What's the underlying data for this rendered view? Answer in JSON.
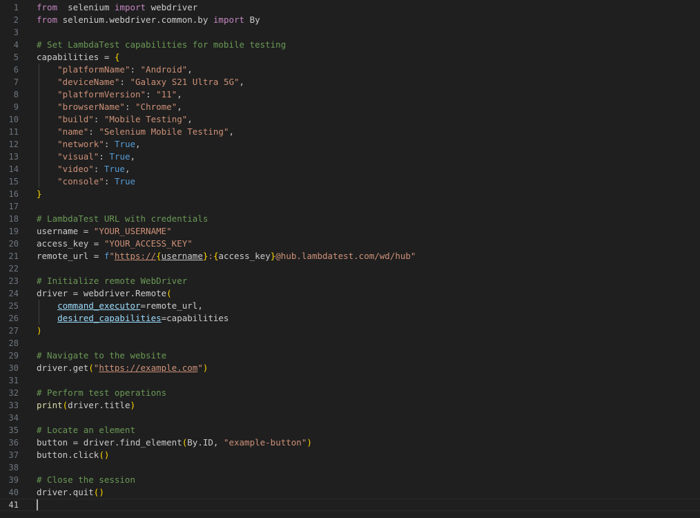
{
  "editor": {
    "current_line": 41,
    "lines": [
      {
        "n": "1",
        "tokens": [
          [
            "kw",
            "from"
          ],
          [
            "",
            "  selenium "
          ],
          [
            "kw",
            "import"
          ],
          [
            "",
            " webdriver"
          ]
        ]
      },
      {
        "n": "2",
        "tokens": [
          [
            "kw",
            "from"
          ],
          [
            "",
            " selenium.webdriver.common.by "
          ],
          [
            "kw",
            "import"
          ],
          [
            "",
            " By"
          ]
        ]
      },
      {
        "n": "3",
        "tokens": []
      },
      {
        "n": "4",
        "tokens": [
          [
            "cm",
            "# Set LambdaTest capabilities for mobile testing"
          ]
        ]
      },
      {
        "n": "5",
        "tokens": [
          [
            "",
            "capabilities = "
          ],
          [
            "br1",
            "{"
          ]
        ]
      },
      {
        "n": "6",
        "tokens": [
          [
            "",
            "    "
          ],
          [
            "st",
            "\"platformName\""
          ],
          [
            "",
            ": "
          ],
          [
            "st",
            "\"Android\""
          ],
          [
            "",
            ","
          ]
        ]
      },
      {
        "n": "7",
        "tokens": [
          [
            "",
            "    "
          ],
          [
            "st",
            "\"deviceName\""
          ],
          [
            "",
            ": "
          ],
          [
            "st",
            "\"Galaxy S21 Ultra 5G\""
          ],
          [
            "",
            ","
          ]
        ]
      },
      {
        "n": "8",
        "tokens": [
          [
            "",
            "    "
          ],
          [
            "st",
            "\"platformVersion\""
          ],
          [
            "",
            ": "
          ],
          [
            "st",
            "\"11\""
          ],
          [
            "",
            ","
          ]
        ]
      },
      {
        "n": "9",
        "tokens": [
          [
            "",
            "    "
          ],
          [
            "st",
            "\"browserName\""
          ],
          [
            "",
            ": "
          ],
          [
            "st",
            "\"Chrome\""
          ],
          [
            "",
            ","
          ]
        ]
      },
      {
        "n": "10",
        "tokens": [
          [
            "",
            "    "
          ],
          [
            "st",
            "\"build\""
          ],
          [
            "",
            ": "
          ],
          [
            "st",
            "\"Mobile Testing\""
          ],
          [
            "",
            ","
          ]
        ]
      },
      {
        "n": "11",
        "tokens": [
          [
            "",
            "    "
          ],
          [
            "st",
            "\"name\""
          ],
          [
            "",
            ": "
          ],
          [
            "st",
            "\"Selenium Mobile Testing\""
          ],
          [
            "",
            ","
          ]
        ]
      },
      {
        "n": "12",
        "tokens": [
          [
            "",
            "    "
          ],
          [
            "st",
            "\"network\""
          ],
          [
            "",
            ": "
          ],
          [
            "bl",
            "True"
          ],
          [
            "",
            ","
          ]
        ]
      },
      {
        "n": "13",
        "tokens": [
          [
            "",
            "    "
          ],
          [
            "st",
            "\"visual\""
          ],
          [
            "",
            ": "
          ],
          [
            "bl",
            "True"
          ],
          [
            "",
            ","
          ]
        ]
      },
      {
        "n": "14",
        "tokens": [
          [
            "",
            "    "
          ],
          [
            "st",
            "\"video\""
          ],
          [
            "",
            ": "
          ],
          [
            "bl",
            "True"
          ],
          [
            "",
            ","
          ]
        ]
      },
      {
        "n": "15",
        "tokens": [
          [
            "",
            "    "
          ],
          [
            "st",
            "\"console\""
          ],
          [
            "",
            ": "
          ],
          [
            "bl",
            "True"
          ]
        ]
      },
      {
        "n": "16",
        "tokens": [
          [
            "br1",
            "}"
          ]
        ]
      },
      {
        "n": "17",
        "tokens": []
      },
      {
        "n": "18",
        "tokens": [
          [
            "cm",
            "# LambdaTest URL with credentials"
          ]
        ]
      },
      {
        "n": "19",
        "tokens": [
          [
            "",
            "username = "
          ],
          [
            "st",
            "\"YOUR_USERNAME\""
          ]
        ]
      },
      {
        "n": "20",
        "tokens": [
          [
            "",
            "access_key = "
          ],
          [
            "st",
            "\"YOUR_ACCESS_KEY\""
          ]
        ]
      },
      {
        "n": "21",
        "tokens": [
          [
            "",
            "remote_url = "
          ],
          [
            "bl",
            "f"
          ],
          [
            "st",
            "\""
          ],
          [
            "st u",
            "https://"
          ],
          [
            "br1",
            "{"
          ],
          [
            "u",
            "username"
          ],
          [
            "br1",
            "}"
          ],
          [
            "st",
            ":"
          ],
          [
            "br1",
            "{"
          ],
          [
            "",
            "access_key"
          ],
          [
            "br1",
            "}"
          ],
          [
            "st",
            "@hub.lambdatest.com/wd/hub\""
          ]
        ]
      },
      {
        "n": "22",
        "tokens": []
      },
      {
        "n": "23",
        "tokens": [
          [
            "cm",
            "# Initialize remote WebDriver"
          ]
        ]
      },
      {
        "n": "24",
        "tokens": [
          [
            "",
            "driver = webdriver.Remote"
          ],
          [
            "br1",
            "("
          ]
        ]
      },
      {
        "n": "25",
        "tokens": [
          [
            "",
            "    "
          ],
          [
            "pa u",
            "command_executor"
          ],
          [
            "",
            "=remote_url,"
          ]
        ]
      },
      {
        "n": "26",
        "tokens": [
          [
            "",
            "    "
          ],
          [
            "pa u",
            "desired_capabilities"
          ],
          [
            "",
            "=capabilities"
          ]
        ]
      },
      {
        "n": "27",
        "tokens": [
          [
            "br1",
            ")"
          ]
        ]
      },
      {
        "n": "28",
        "tokens": []
      },
      {
        "n": "29",
        "tokens": [
          [
            "cm",
            "# Navigate to the website"
          ]
        ]
      },
      {
        "n": "30",
        "tokens": [
          [
            "",
            "driver.get"
          ],
          [
            "br1",
            "("
          ],
          [
            "st",
            "\""
          ],
          [
            "st u",
            "https://example.com"
          ],
          [
            "st",
            "\""
          ],
          [
            "br1",
            ")"
          ]
        ]
      },
      {
        "n": "31",
        "tokens": []
      },
      {
        "n": "32",
        "tokens": [
          [
            "cm",
            "# Perform test operations"
          ]
        ]
      },
      {
        "n": "33",
        "tokens": [
          [
            "fn",
            "print"
          ],
          [
            "br1",
            "("
          ],
          [
            "",
            "driver.title"
          ],
          [
            "br1",
            ")"
          ]
        ]
      },
      {
        "n": "34",
        "tokens": []
      },
      {
        "n": "35",
        "tokens": [
          [
            "cm",
            "# Locate an element"
          ]
        ]
      },
      {
        "n": "36",
        "tokens": [
          [
            "",
            "button = driver.find_element"
          ],
          [
            "br1",
            "("
          ],
          [
            "",
            "By.ID, "
          ],
          [
            "st",
            "\"example-button\""
          ],
          [
            "br1",
            ")"
          ]
        ]
      },
      {
        "n": "37",
        "tokens": [
          [
            "",
            "button.click"
          ],
          [
            "br1",
            "("
          ],
          [
            "br1",
            ")"
          ]
        ]
      },
      {
        "n": "38",
        "tokens": []
      },
      {
        "n": "39",
        "tokens": [
          [
            "cm",
            "# Close the session"
          ]
        ]
      },
      {
        "n": "40",
        "tokens": [
          [
            "",
            "driver.quit"
          ],
          [
            "br1",
            "("
          ],
          [
            "br1",
            ")"
          ]
        ]
      },
      {
        "n": "41",
        "tokens": []
      }
    ]
  }
}
